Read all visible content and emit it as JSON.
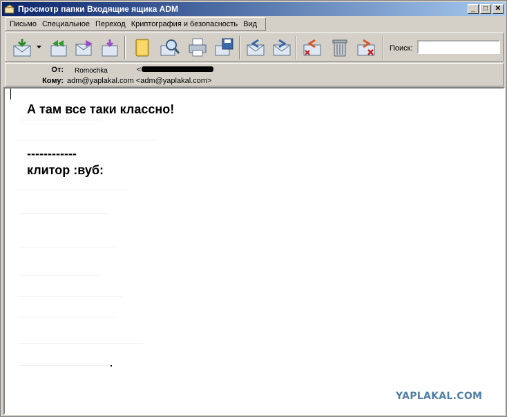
{
  "window": {
    "title": "Просмотр папки Входящие ящика ADM",
    "controls": {
      "minimize": "_",
      "maximize": "□",
      "close": "✕"
    }
  },
  "menu": {
    "items": [
      {
        "label": "Письмо"
      },
      {
        "label": "Специальное"
      },
      {
        "label": "Переход"
      },
      {
        "label": "Криптография и безопасность"
      },
      {
        "label": "Вид"
      }
    ]
  },
  "toolbar": {
    "buttons": [
      {
        "icon": "receive-mail-icon"
      },
      {
        "icon": "reply-all-icon"
      },
      {
        "icon": "forward-icon"
      },
      {
        "icon": "redirect-icon"
      },
      {
        "icon": "address-book-icon"
      },
      {
        "icon": "find-icon"
      },
      {
        "icon": "print-icon"
      },
      {
        "icon": "save-icon"
      },
      {
        "icon": "previous-message-icon"
      },
      {
        "icon": "next-message-icon"
      },
      {
        "icon": "delete-message-icon"
      },
      {
        "icon": "trash-icon"
      },
      {
        "icon": "delete-forever-icon"
      }
    ],
    "search_label": "Поиск:",
    "search_value": ""
  },
  "header": {
    "from_label": "От:",
    "from_name": "Romochka",
    "from_address_open": "<",
    "to_label": "Кому:",
    "to_value": "adm@yaplakal.com <adm@yaplakal.com>"
  },
  "message": {
    "line1": "А там все таки классно!",
    "line2": "------------",
    "line3": "клитор :вуб:"
  },
  "watermark": "YAPLAKAL.COM",
  "colors": {
    "titlebar_start": "#0a246a",
    "titlebar_end": "#a6caf0",
    "chrome": "#d4d0c8",
    "watermark": "#4f7ea6"
  }
}
